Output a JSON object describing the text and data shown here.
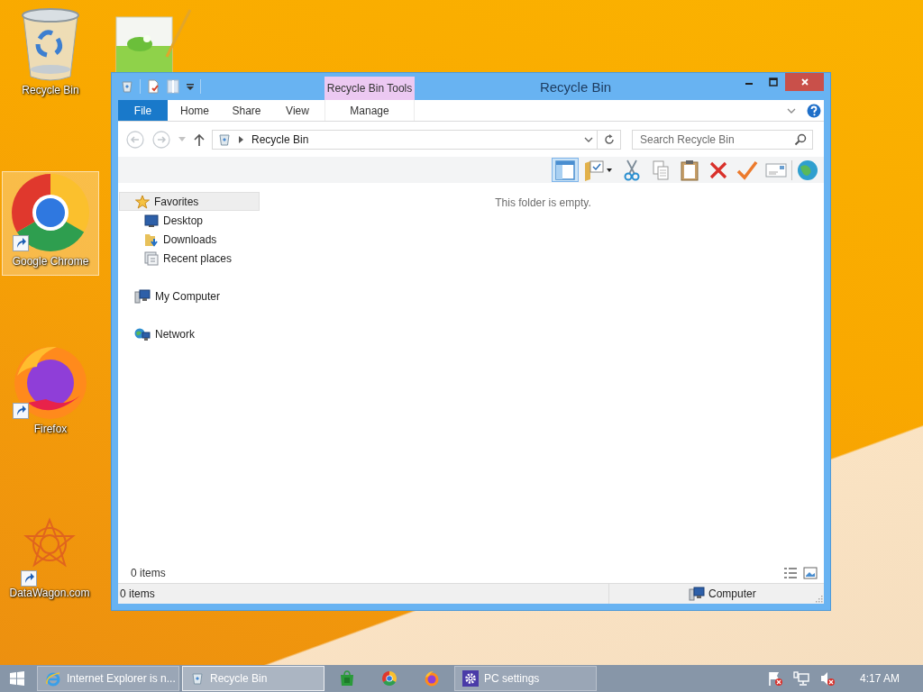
{
  "desktop_icons": [
    {
      "kind": "recycle-bin",
      "label": "Recycle Bin",
      "selected": false,
      "shortcut": false
    },
    {
      "kind": "notepad",
      "selected": false,
      "shortcut": false
    },
    {
      "kind": "chrome",
      "label": "Google Chrome",
      "selected": true,
      "shortcut": true
    },
    {
      "kind": "firefox",
      "label": "Firefox",
      "selected": false,
      "shortcut": true
    },
    {
      "kind": "datawagon",
      "label": "DataWagon.com",
      "selected": false,
      "shortcut": true
    }
  ],
  "window": {
    "title": "Recycle Bin",
    "contextual_group": "Recycle Bin Tools",
    "ribbon_tabs": [
      {
        "label": "File",
        "kind": "file",
        "selected": false
      },
      {
        "label": "Home",
        "kind": "tab",
        "selected": false
      },
      {
        "label": "Share",
        "kind": "tab",
        "selected": false
      },
      {
        "label": "View",
        "kind": "tab",
        "selected": false
      },
      {
        "label": "Manage",
        "kind": "contextual",
        "selected": false
      }
    ],
    "address": {
      "path": "Recycle Bin"
    },
    "search": {
      "placeholder": "Search Recycle Bin"
    },
    "toolbar": [
      {
        "kind": "layout",
        "selected": true
      },
      {
        "kind": "folder-options",
        "selected": false
      },
      {
        "kind": "cut",
        "selected": false
      },
      {
        "kind": "copy",
        "selected": false
      },
      {
        "kind": "paste",
        "selected": false
      },
      {
        "kind": "delete",
        "selected": false
      },
      {
        "kind": "check",
        "selected": false
      },
      {
        "kind": "mail",
        "selected": false
      },
      {
        "kind": "shell",
        "selected": false
      }
    ],
    "navigation": [
      {
        "label": "Favorites",
        "kind": "favorites",
        "selected": true,
        "children": [
          {
            "label": "Desktop",
            "kind": "desktop",
            "selected": false
          },
          {
            "label": "Downloads",
            "kind": "downloads",
            "selected": false
          },
          {
            "label": "Recent places",
            "kind": "recent",
            "selected": false
          }
        ]
      },
      {
        "label": "My Computer",
        "kind": "computer",
        "selected": false
      },
      {
        "label": "Network",
        "kind": "network",
        "selected": false
      }
    ],
    "empty_message": "This folder is empty.",
    "item_count": "0 items",
    "status_bar": {
      "item_count": "0 items",
      "location": "Computer"
    }
  },
  "taskbar": {
    "buttons": [
      {
        "kind": "ie",
        "label": "Internet Explorer is n...",
        "selected": false
      },
      {
        "kind": "recycle-bin",
        "label": "Recycle Bin",
        "selected": true
      },
      {
        "kind": "store",
        "selected": false
      },
      {
        "kind": "chrome",
        "selected": false
      },
      {
        "kind": "firefox",
        "selected": false
      },
      {
        "kind": "settings",
        "label": "PC settings",
        "selected": false
      }
    ],
    "clock": "4:17 AM"
  }
}
